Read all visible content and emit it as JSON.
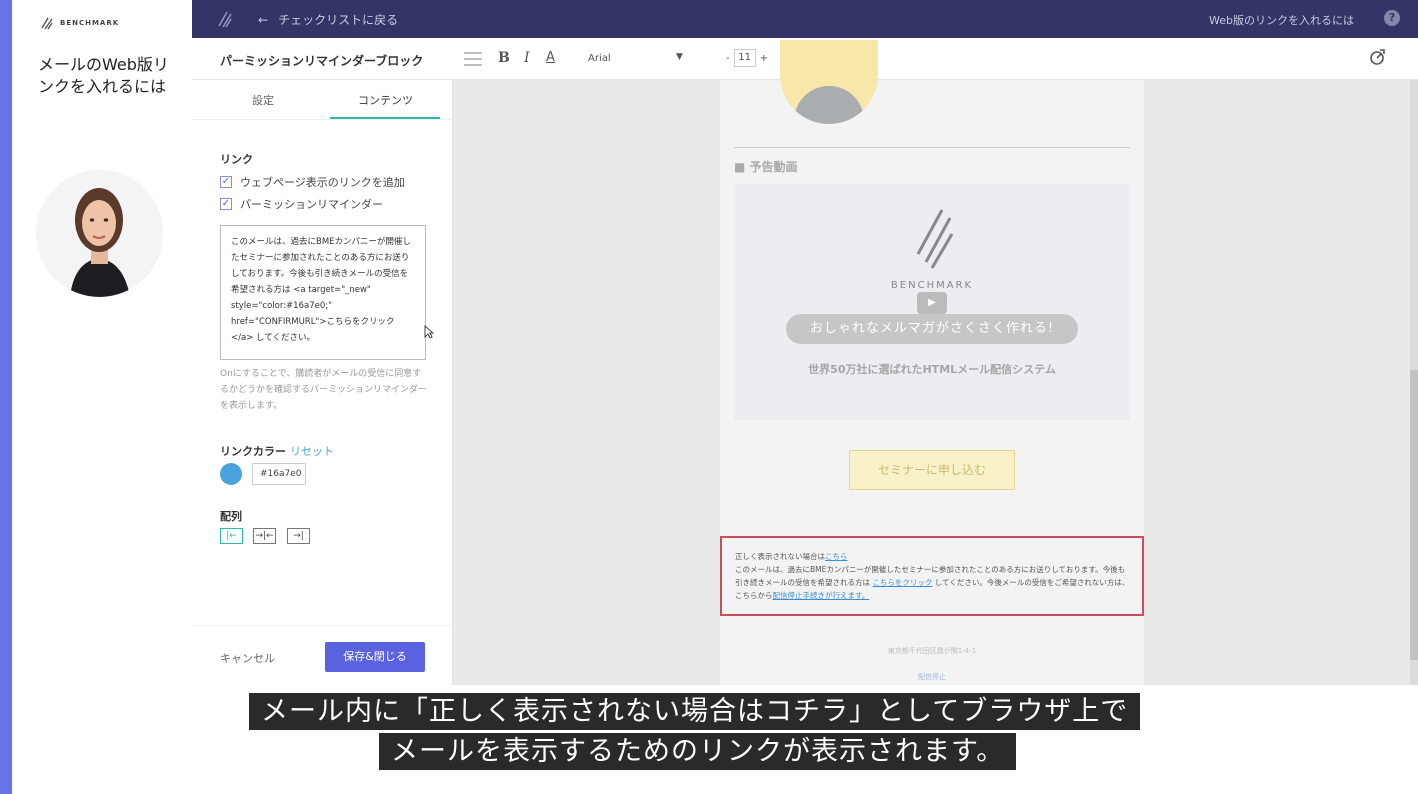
{
  "sidebar": {
    "brand": "BENCHMARK",
    "title": "メールのWeb版リンクを入れるには"
  },
  "topbar": {
    "back_label": "チェックリストに戻る",
    "help_text": "Web版のリンクを入れるには",
    "help_icon": "?"
  },
  "toolbar": {
    "block_title": "パーミッションリマインダーブロック",
    "bold": "B",
    "italic": "I",
    "color": "A",
    "font": "Arial",
    "size_minus": "-",
    "size": "11",
    "size_plus": "+"
  },
  "panel": {
    "tabs": [
      "設定",
      "コンテンツ"
    ],
    "active_tab": "コンテンツ",
    "link_label": "リンク",
    "checkbox_webpage": "ウェブページ表示のリンクを追加",
    "checkbox_reminder": "パーミッションリマインダー",
    "reminder_text": "このメールは、過去にBMEカンパニーが開催したセミナーに参加されたことのある方にお送りしております。今後も引き続きメールの受信を希望される方は <a target=\"_new\" style=\"color:#16a7e0;\" href=\"CONFIRMURL\">こちらをクリック</a> してください。",
    "help_text": "Onにすることで、購読者がメールの受信に同意するかどうかを確認するパーミッションリマインダーを表示します。",
    "link_color_label": "リンクカラー",
    "reset_label": "リセット",
    "link_color_value": "#16a7e0",
    "align_label": "配列",
    "align_options": [
      "|←",
      "→|←",
      "→|"
    ],
    "cancel": "キャンセル",
    "save": "保存&閉じる"
  },
  "email": {
    "section_title": "■ 予告動画",
    "video_brand": "BENCHMARK",
    "video_pill": "おしゃれなメルマガがさくさく作れる!",
    "video_sub": "世界50万社に選ばれたHTMLメール配信システム",
    "cta": "セミナーに申し込む",
    "footer_line1": "正しく表示されない場合は",
    "footer_link1": "こちら",
    "footer_body": "このメールは、過去にBMEカンパニーが開催したセミナーに参加されたことのある方にお送りしております。今後も引き続きメールの受信を希望される方は ",
    "footer_link2": "こちらをクリック",
    "footer_body2": " してください。今後メールの受信をご希望されない方は、こちらから",
    "footer_link3": "配信停止手続きが行えます。",
    "address": "東京都千代田区霞が関1-4-1",
    "unsubscribe": "配信停止"
  },
  "captions": {
    "line1": "メール内に「正しく表示されない場合はコチラ」としてブラウザ上で",
    "line2": "メールを表示するためのリンクが表示されます。"
  },
  "colors": {
    "accent": "#5b62e0",
    "topbar": "#343566",
    "tab_active": "#2fb8a5",
    "highlight_border": "#d0495c",
    "link_color": "#4aa3dc"
  }
}
